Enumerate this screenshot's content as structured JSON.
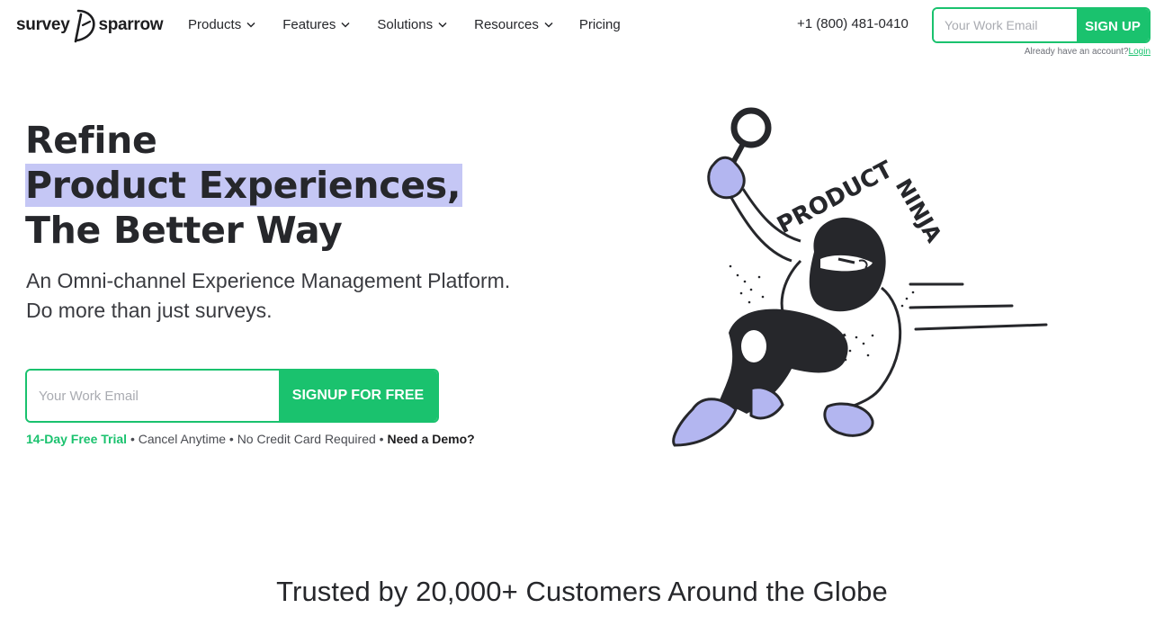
{
  "header": {
    "logo_left": "survey",
    "logo_right": "sparrow",
    "nav": [
      {
        "label": "Products",
        "has_dropdown": true
      },
      {
        "label": "Features",
        "has_dropdown": true
      },
      {
        "label": "Solutions",
        "has_dropdown": true
      },
      {
        "label": "Resources",
        "has_dropdown": true
      },
      {
        "label": "Pricing",
        "has_dropdown": false
      }
    ],
    "phone": "+1 (800) 481-0410",
    "email_placeholder": "Your Work Email",
    "signup_label": "SIGN UP",
    "already_text": "Already have an account?",
    "login_label": "Login"
  },
  "hero": {
    "title_line1": "Refine",
    "title_line2": "Product Experiences,",
    "title_line3": "The Better Way",
    "subtitle_line1": "An Omni-channel Experience Management Platform.",
    "subtitle_line2": "Do more than just surveys.",
    "email_placeholder": "Your Work Email",
    "cta_label": "SIGNUP FOR FREE",
    "meta_trial": "14-Day Free Trial",
    "meta_cancel": " • Cancel Anytime • No Credit Card Required • ",
    "meta_demo": "Need a Demo?",
    "illustration_text": "PRODUCT NINJA"
  },
  "trusted": {
    "text": "Trusted by 20,000+ Customers Around the Globe"
  },
  "colors": {
    "brand_green": "#1ac26e",
    "highlight": "#c5c7f5",
    "ninja_glove": "#b3b6f0",
    "text_dark": "#26272b"
  }
}
